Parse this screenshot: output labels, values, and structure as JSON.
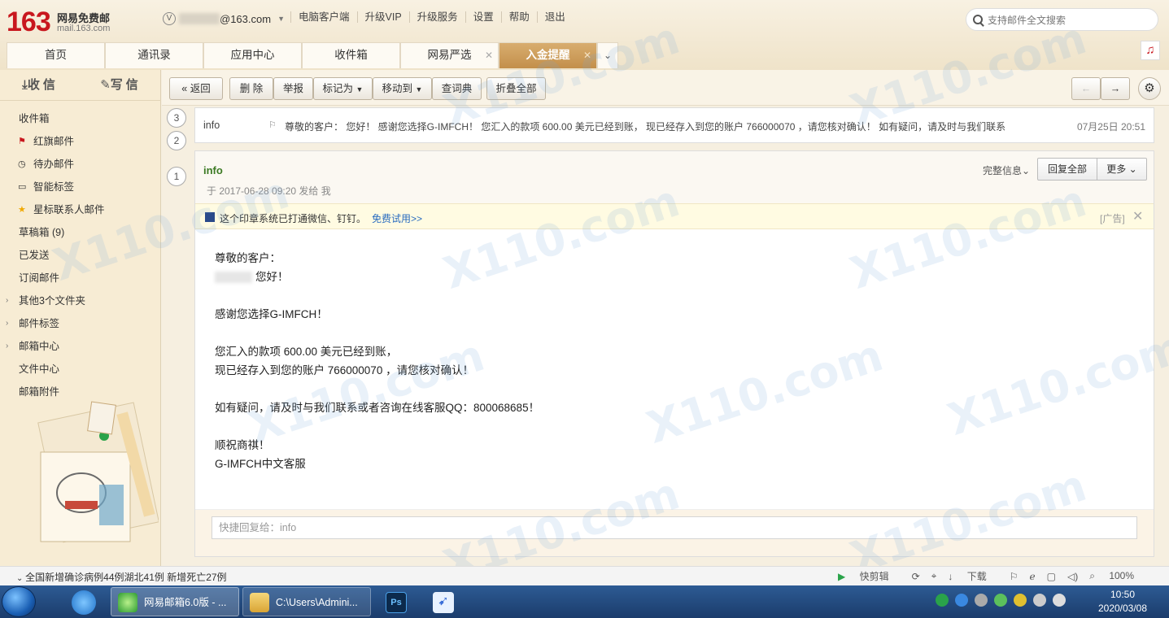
{
  "logo": {
    "number": "163",
    "name": "网易免费邮",
    "domain": "mail.163.com"
  },
  "account": {
    "badge": "V",
    "email_suffix": "@163.com"
  },
  "topnav": [
    "电脑客户端",
    "升级VIP",
    "升级服务",
    "设置",
    "帮助",
    "退出"
  ],
  "search": {
    "placeholder": "支持邮件全文搜索"
  },
  "tabs": [
    "首页",
    "通讯录",
    "应用中心",
    "收件箱",
    "网易严选",
    "入金提醒"
  ],
  "sidebar": {
    "receive": "收信",
    "compose": "写信",
    "folders": [
      "收件箱",
      "红旗邮件",
      "待办邮件",
      "智能标签",
      "星标联系人邮件",
      "草稿箱 (9)",
      "已发送",
      "订阅邮件",
      "其他3个文件夹",
      "邮件标签",
      "邮箱中心",
      "文件中心",
      "邮箱附件"
    ]
  },
  "toolbar": {
    "back": "返回",
    "delete": "删 除",
    "report": "举报",
    "mark": "标记为",
    "move": "移动到",
    "dict": "查词典",
    "collapse": "折叠全部"
  },
  "thread": {
    "row3": {
      "num": "3",
      "from": "info",
      "summary": "尊敬的客户：        您好！ 感谢您选择G-IMFCH！ 您汇入的款项 600.00 美元已经到账， 现已经存入到您的账户 766000070 ，请您核对确认！ 如有疑问，请及时与我们联系",
      "date": "07月25日 20:51"
    },
    "row2_num": "2",
    "row1_num": "1"
  },
  "mail": {
    "sender": "info",
    "sent_line": "于 2017-06-28 09:20 发给 我",
    "full_info": "完整信息",
    "reply_all": "回复全部",
    "more": "更多",
    "ad": {
      "text": "这个印章系统已打通微信、钉钉。",
      "link": "免费试用>>",
      "tag": "[广告]",
      "close": "✕"
    },
    "body": {
      "greeting": "尊敬的客户：",
      "hello": "您好！",
      "thanks": "感谢您选择G-IMFCH！",
      "line1": "您汇入的款项 600.00 美元已经到账，",
      "line2": "现已经存入到您的账户 766000070 ，请您核对确认！",
      "line3": "如有疑问，请及时与我们联系或者咨询在线客服QQ：800068685！",
      "closing": "顺祝商祺！",
      "signature": "G-IMFCH中文客服"
    },
    "quick_reply_placeholder": "快捷回复给：info"
  },
  "statusbar": {
    "news": "全国新增确诊病例44例湖北41例 新增死亡27例",
    "clip": "快剪辑",
    "download": "下载",
    "zoom": "100%"
  },
  "taskbar": {
    "items": [
      "网易邮箱6.0版 - ...",
      "C:\\Users\\Admini..."
    ],
    "time": "10:50",
    "date": "2020/03/08"
  },
  "watermark": "X110.com"
}
